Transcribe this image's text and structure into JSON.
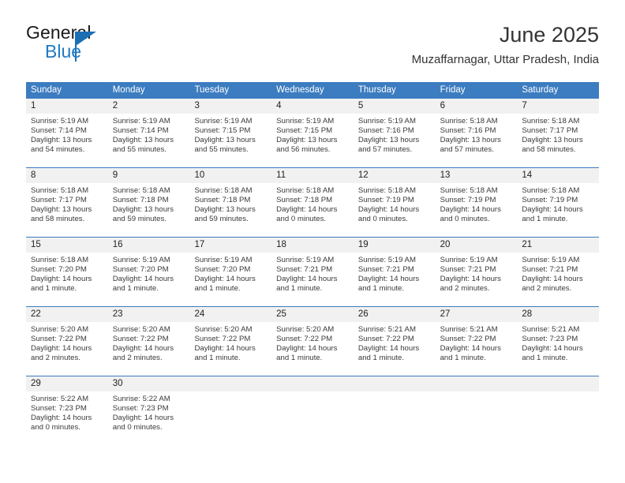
{
  "brand": {
    "name_part1": "General",
    "name_part2": "Blue",
    "logo_icon": "triangle-flag-icon"
  },
  "header": {
    "month_title": "June 2025",
    "location": "Muzaffarnagar, Uttar Pradesh, India"
  },
  "colors": {
    "header_blue": "#3c7cc0",
    "brand_blue": "#1f7ac4",
    "day_band_gray": "#f1f1f1",
    "text": "#333333"
  },
  "calendar": {
    "weekdays": [
      "Sunday",
      "Monday",
      "Tuesday",
      "Wednesday",
      "Thursday",
      "Friday",
      "Saturday"
    ],
    "weeks": [
      [
        {
          "day": "1",
          "sunrise": "Sunrise: 5:19 AM",
          "sunset": "Sunset: 7:14 PM",
          "daylight": "Daylight: 13 hours and 54 minutes."
        },
        {
          "day": "2",
          "sunrise": "Sunrise: 5:19 AM",
          "sunset": "Sunset: 7:14 PM",
          "daylight": "Daylight: 13 hours and 55 minutes."
        },
        {
          "day": "3",
          "sunrise": "Sunrise: 5:19 AM",
          "sunset": "Sunset: 7:15 PM",
          "daylight": "Daylight: 13 hours and 55 minutes."
        },
        {
          "day": "4",
          "sunrise": "Sunrise: 5:19 AM",
          "sunset": "Sunset: 7:15 PM",
          "daylight": "Daylight: 13 hours and 56 minutes."
        },
        {
          "day": "5",
          "sunrise": "Sunrise: 5:19 AM",
          "sunset": "Sunset: 7:16 PM",
          "daylight": "Daylight: 13 hours and 57 minutes."
        },
        {
          "day": "6",
          "sunrise": "Sunrise: 5:18 AM",
          "sunset": "Sunset: 7:16 PM",
          "daylight": "Daylight: 13 hours and 57 minutes."
        },
        {
          "day": "7",
          "sunrise": "Sunrise: 5:18 AM",
          "sunset": "Sunset: 7:17 PM",
          "daylight": "Daylight: 13 hours and 58 minutes."
        }
      ],
      [
        {
          "day": "8",
          "sunrise": "Sunrise: 5:18 AM",
          "sunset": "Sunset: 7:17 PM",
          "daylight": "Daylight: 13 hours and 58 minutes."
        },
        {
          "day": "9",
          "sunrise": "Sunrise: 5:18 AM",
          "sunset": "Sunset: 7:18 PM",
          "daylight": "Daylight: 13 hours and 59 minutes."
        },
        {
          "day": "10",
          "sunrise": "Sunrise: 5:18 AM",
          "sunset": "Sunset: 7:18 PM",
          "daylight": "Daylight: 13 hours and 59 minutes."
        },
        {
          "day": "11",
          "sunrise": "Sunrise: 5:18 AM",
          "sunset": "Sunset: 7:18 PM",
          "daylight": "Daylight: 14 hours and 0 minutes."
        },
        {
          "day": "12",
          "sunrise": "Sunrise: 5:18 AM",
          "sunset": "Sunset: 7:19 PM",
          "daylight": "Daylight: 14 hours and 0 minutes."
        },
        {
          "day": "13",
          "sunrise": "Sunrise: 5:18 AM",
          "sunset": "Sunset: 7:19 PM",
          "daylight": "Daylight: 14 hours and 0 minutes."
        },
        {
          "day": "14",
          "sunrise": "Sunrise: 5:18 AM",
          "sunset": "Sunset: 7:19 PM",
          "daylight": "Daylight: 14 hours and 1 minute."
        }
      ],
      [
        {
          "day": "15",
          "sunrise": "Sunrise: 5:18 AM",
          "sunset": "Sunset: 7:20 PM",
          "daylight": "Daylight: 14 hours and 1 minute."
        },
        {
          "day": "16",
          "sunrise": "Sunrise: 5:19 AM",
          "sunset": "Sunset: 7:20 PM",
          "daylight": "Daylight: 14 hours and 1 minute."
        },
        {
          "day": "17",
          "sunrise": "Sunrise: 5:19 AM",
          "sunset": "Sunset: 7:20 PM",
          "daylight": "Daylight: 14 hours and 1 minute."
        },
        {
          "day": "18",
          "sunrise": "Sunrise: 5:19 AM",
          "sunset": "Sunset: 7:21 PM",
          "daylight": "Daylight: 14 hours and 1 minute."
        },
        {
          "day": "19",
          "sunrise": "Sunrise: 5:19 AM",
          "sunset": "Sunset: 7:21 PM",
          "daylight": "Daylight: 14 hours and 1 minute."
        },
        {
          "day": "20",
          "sunrise": "Sunrise: 5:19 AM",
          "sunset": "Sunset: 7:21 PM",
          "daylight": "Daylight: 14 hours and 2 minutes."
        },
        {
          "day": "21",
          "sunrise": "Sunrise: 5:19 AM",
          "sunset": "Sunset: 7:21 PM",
          "daylight": "Daylight: 14 hours and 2 minutes."
        }
      ],
      [
        {
          "day": "22",
          "sunrise": "Sunrise: 5:20 AM",
          "sunset": "Sunset: 7:22 PM",
          "daylight": "Daylight: 14 hours and 2 minutes."
        },
        {
          "day": "23",
          "sunrise": "Sunrise: 5:20 AM",
          "sunset": "Sunset: 7:22 PM",
          "daylight": "Daylight: 14 hours and 2 minutes."
        },
        {
          "day": "24",
          "sunrise": "Sunrise: 5:20 AM",
          "sunset": "Sunset: 7:22 PM",
          "daylight": "Daylight: 14 hours and 1 minute."
        },
        {
          "day": "25",
          "sunrise": "Sunrise: 5:20 AM",
          "sunset": "Sunset: 7:22 PM",
          "daylight": "Daylight: 14 hours and 1 minute."
        },
        {
          "day": "26",
          "sunrise": "Sunrise: 5:21 AM",
          "sunset": "Sunset: 7:22 PM",
          "daylight": "Daylight: 14 hours and 1 minute."
        },
        {
          "day": "27",
          "sunrise": "Sunrise: 5:21 AM",
          "sunset": "Sunset: 7:22 PM",
          "daylight": "Daylight: 14 hours and 1 minute."
        },
        {
          "day": "28",
          "sunrise": "Sunrise: 5:21 AM",
          "sunset": "Sunset: 7:23 PM",
          "daylight": "Daylight: 14 hours and 1 minute."
        }
      ],
      [
        {
          "day": "29",
          "sunrise": "Sunrise: 5:22 AM",
          "sunset": "Sunset: 7:23 PM",
          "daylight": "Daylight: 14 hours and 0 minutes."
        },
        {
          "day": "30",
          "sunrise": "Sunrise: 5:22 AM",
          "sunset": "Sunset: 7:23 PM",
          "daylight": "Daylight: 14 hours and 0 minutes."
        },
        {
          "day": "",
          "sunrise": "",
          "sunset": "",
          "daylight": ""
        },
        {
          "day": "",
          "sunrise": "",
          "sunset": "",
          "daylight": ""
        },
        {
          "day": "",
          "sunrise": "",
          "sunset": "",
          "daylight": ""
        },
        {
          "day": "",
          "sunrise": "",
          "sunset": "",
          "daylight": ""
        },
        {
          "day": "",
          "sunrise": "",
          "sunset": "",
          "daylight": ""
        }
      ]
    ]
  }
}
